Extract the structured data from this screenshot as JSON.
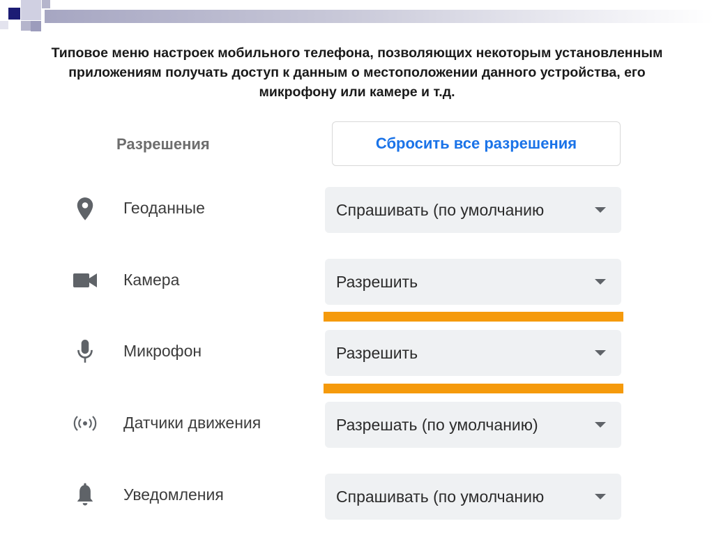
{
  "slide": {
    "title": "Типовое меню настроек мобильного телефона, позволяющих некоторым установленным приложениям получать доступ к данным о местоположении данного устройства, его микрофону или камере и т.д."
  },
  "permissions": {
    "header": "Разрешения",
    "reset_button": "Сбросить все разрешения",
    "accent_color": "#1a73e8",
    "highlight_color": "#f59a0c",
    "rows": [
      {
        "icon": "location-pin-icon",
        "label": "Геоданные",
        "value": "Спрашивать (по умолчанию"
      },
      {
        "icon": "camera-icon",
        "label": "Камера",
        "value": "Разрешить"
      },
      {
        "icon": "microphone-icon",
        "label": "Микрофон",
        "value": "Разрешить"
      },
      {
        "icon": "motion-sensor-icon",
        "label": "Датчики движения",
        "value": "Разрешать (по умолчанию)"
      },
      {
        "icon": "bell-icon",
        "label": "Уведомления",
        "value": "Спрашивать (по умолчанию"
      }
    ]
  }
}
